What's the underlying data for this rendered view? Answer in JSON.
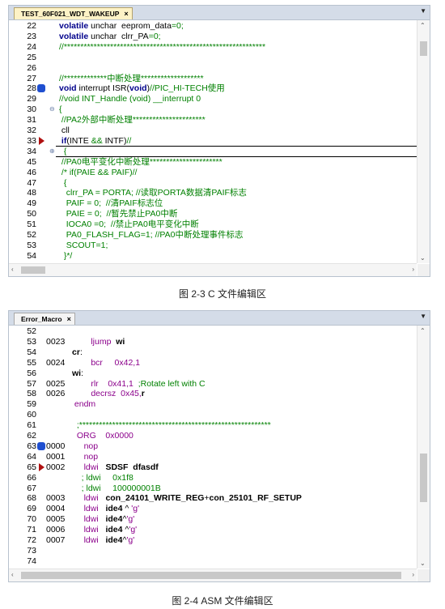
{
  "fig1": {
    "tab_label": "TEST_60F021_WDT_WAKEUP",
    "caption": "图 2-3 C 文件编辑区",
    "lines": [
      {
        "n": "22",
        "parts": [
          [
            "k",
            "volatile"
          ],
          [
            "nm",
            " unchar  eeprom_data"
          ],
          [
            "cm",
            "=0;"
          ]
        ]
      },
      {
        "n": "23",
        "parts": [
          [
            "k",
            "volatile"
          ],
          [
            "nm",
            " unchar  clrr_PA"
          ],
          [
            "cm",
            "=0;"
          ]
        ]
      },
      {
        "n": "24",
        "parts": [
          [
            "cm",
            "//*************************************************************"
          ]
        ]
      },
      {
        "n": "25",
        "parts": []
      },
      {
        "n": "26",
        "parts": []
      },
      {
        "n": "27",
        "parts": [
          [
            "cm",
            "//*************中断处理*******************"
          ]
        ]
      },
      {
        "n": "28",
        "parts": [
          [
            "k",
            "void"
          ],
          [
            "nm",
            " interrupt ISR("
          ],
          [
            "k",
            "void"
          ],
          [
            "nm",
            ")"
          ],
          [
            "cm",
            "//PIC_HI-TECH使用"
          ]
        ]
      },
      {
        "n": "29",
        "parts": [
          [
            "cm",
            "//void INT_Handle (void) __interrupt 0"
          ]
        ]
      },
      {
        "n": "30",
        "parts": [
          [
            "cm",
            "{"
          ]
        ]
      },
      {
        "n": "31",
        "parts": [
          [
            "cm",
            " //PA2外部中断处理**********************"
          ]
        ]
      },
      {
        "n": "32",
        "parts": [
          [
            "nm",
            " cll"
          ]
        ]
      },
      {
        "n": "33",
        "parts": [
          [
            "k",
            " if"
          ],
          [
            "nm",
            "(INTE "
          ],
          [
            "cm",
            "&&"
          ],
          [
            "nm",
            " INTF)"
          ],
          [
            "cm",
            "//"
          ]
        ]
      },
      {
        "n": "34",
        "parts": [
          [
            "cm",
            "  {"
          ]
        ]
      },
      {
        "n": "45",
        "parts": [
          [
            "cm",
            " //PA0电平变化中断处理**********************"
          ]
        ]
      },
      {
        "n": "46",
        "parts": [
          [
            "cm",
            " /* if(PAIE && PAIF)//"
          ]
        ]
      },
      {
        "n": "47",
        "parts": [
          [
            "cm",
            "  {"
          ]
        ]
      },
      {
        "n": "48",
        "parts": [
          [
            "cm",
            "   clrr_PA = PORTA; //读取PORTA数据清PAIF标志"
          ]
        ]
      },
      {
        "n": "49",
        "parts": [
          [
            "cm",
            "   PAIF = 0;  //清PAIF标志位"
          ]
        ]
      },
      {
        "n": "50",
        "parts": [
          [
            "cm",
            "   PAIE = 0;  //暂先禁止PA0中断"
          ]
        ]
      },
      {
        "n": "51",
        "parts": [
          [
            "cm",
            "   IOCA0 =0;  //禁止PA0电平变化中断"
          ]
        ]
      },
      {
        "n": "52",
        "parts": [
          [
            "cm",
            "   PA0_FLASH_FLAG=1; //PA0中断处理事件标志"
          ]
        ]
      },
      {
        "n": "53",
        "parts": [
          [
            "cm",
            "   SCOUT=1;"
          ]
        ]
      },
      {
        "n": "54",
        "parts": [
          [
            "cm",
            "  }*/"
          ]
        ]
      }
    ]
  },
  "fig2": {
    "tab_label": "Error_Macro",
    "caption": "图 2-4 ASM 文件编辑区",
    "lines": [
      {
        "n": "52",
        "addr": "",
        "parts": []
      },
      {
        "n": "53",
        "addr": "0023",
        "parts": [
          [
            "mg",
            "        ljump  "
          ],
          [
            "bk",
            "wi"
          ]
        ]
      },
      {
        "n": "54",
        "addr": "",
        "parts": [
          [
            "bk",
            "cr"
          ],
          [
            "nm",
            ":"
          ]
        ]
      },
      {
        "n": "55",
        "addr": "0024",
        "parts": [
          [
            "mg",
            "        bcr     0x42,1"
          ]
        ]
      },
      {
        "n": "56",
        "addr": "",
        "parts": [
          [
            "bk",
            "wi"
          ],
          [
            "nm",
            ":"
          ]
        ]
      },
      {
        "n": "57",
        "addr": "0025",
        "parts": [
          [
            "mg",
            "        rlr    0x41,1  "
          ],
          [
            "cm",
            ";Rotate left with C"
          ]
        ]
      },
      {
        "n": "58",
        "addr": "0026",
        "parts": [
          [
            "mg",
            "        decrsz  0x45,"
          ],
          [
            "bk",
            "r"
          ]
        ]
      },
      {
        "n": "59",
        "addr": "",
        "parts": [
          [
            "mg",
            " endm"
          ]
        ]
      },
      {
        "n": "60",
        "addr": "",
        "parts": []
      },
      {
        "n": "61",
        "addr": "",
        "parts": [
          [
            "cm",
            "  ;**********************************************************"
          ]
        ]
      },
      {
        "n": "62",
        "addr": "",
        "parts": [
          [
            "mg",
            "  ORG    0x0000"
          ]
        ]
      },
      {
        "n": "63",
        "addr": "0000",
        "parts": [
          [
            "mg",
            "     nop"
          ]
        ]
      },
      {
        "n": "64",
        "addr": "0001",
        "parts": [
          [
            "mg",
            "     nop"
          ]
        ]
      },
      {
        "n": "65",
        "addr": "0002",
        "parts": [
          [
            "mg",
            "     ldwi   "
          ],
          [
            "bk",
            "SDSF  dfasdf"
          ]
        ]
      },
      {
        "n": "66",
        "addr": "",
        "parts": [
          [
            "cm",
            "    ; ldwi     0x1f8"
          ]
        ]
      },
      {
        "n": "67",
        "addr": "",
        "parts": [
          [
            "cm",
            "    ; ldwi     100000001B"
          ]
        ]
      },
      {
        "n": "68",
        "addr": "0003",
        "parts": [
          [
            "mg",
            "     ldwi   "
          ],
          [
            "bk",
            "con_24101_WRITE_REG"
          ],
          [
            "nm",
            "+"
          ],
          [
            "bk",
            "con_25101_RF_SETUP"
          ]
        ]
      },
      {
        "n": "69",
        "addr": "0004",
        "parts": [
          [
            "mg",
            "     ldwi   "
          ],
          [
            "bk",
            "ide4"
          ],
          [
            "nm",
            " ^ "
          ],
          [
            "mg",
            "'g'"
          ]
        ]
      },
      {
        "n": "70",
        "addr": "0005",
        "parts": [
          [
            "mg",
            "     ldwi   "
          ],
          [
            "bk",
            "ide4"
          ],
          [
            "nm",
            "^"
          ],
          [
            "mg",
            "'g'"
          ]
        ]
      },
      {
        "n": "71",
        "addr": "0006",
        "parts": [
          [
            "mg",
            "     ldwi   "
          ],
          [
            "bk",
            "ide4 "
          ],
          [
            "nm",
            "^"
          ],
          [
            "mg",
            "'g'"
          ]
        ]
      },
      {
        "n": "72",
        "addr": "0007",
        "parts": [
          [
            "mg",
            "     ldwi   "
          ],
          [
            "bk",
            "ide4"
          ],
          [
            "nm",
            "^"
          ],
          [
            "mg",
            "'g'"
          ]
        ]
      },
      {
        "n": "73",
        "addr": "",
        "parts": []
      },
      {
        "n": "74",
        "addr": "",
        "parts": []
      }
    ]
  },
  "icons": [
    "close-icon",
    "dropdown-icon",
    "breakpoint-icon",
    "current-line-arrow-icon",
    "fold-icon",
    "scroll-up-icon",
    "scroll-down-icon",
    "scroll-left-icon",
    "scroll-right-icon"
  ],
  "colors": {
    "comment": "#008000",
    "keyword": "#00008b",
    "asm": "#8b008b",
    "breakpoint": "#1f4fd0",
    "arrow": "#b01010",
    "tab_active": "#fdf2c6"
  }
}
